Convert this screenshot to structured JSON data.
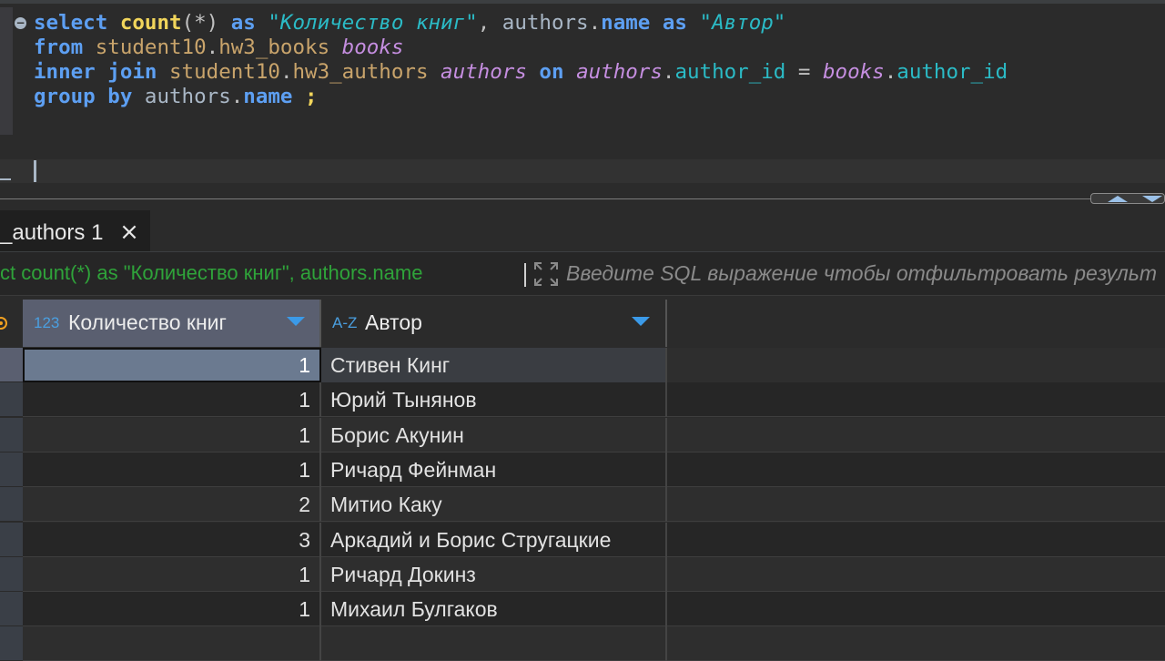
{
  "editor": {
    "lines": [
      [
        {
          "t": "select",
          "c": "kw"
        },
        {
          "t": " ",
          "c": "plain"
        },
        {
          "t": "count",
          "c": "fn"
        },
        {
          "t": "(*)",
          "c": "punct"
        },
        {
          "t": " ",
          "c": "plain"
        },
        {
          "t": "as",
          "c": "kw"
        },
        {
          "t": " ",
          "c": "plain"
        },
        {
          "t": "\"Количество книг\"",
          "c": "str"
        },
        {
          "t": ", ",
          "c": "punct"
        },
        {
          "t": "authors",
          "c": "plain"
        },
        {
          "t": ".",
          "c": "punct"
        },
        {
          "t": "name",
          "c": "kw"
        },
        {
          "t": " ",
          "c": "plain"
        },
        {
          "t": "as",
          "c": "kw"
        },
        {
          "t": " ",
          "c": "plain"
        },
        {
          "t": "\"Автор\"",
          "c": "str"
        }
      ],
      [
        {
          "t": "from",
          "c": "kw"
        },
        {
          "t": " ",
          "c": "plain"
        },
        {
          "t": "student10",
          "c": "schema"
        },
        {
          "t": ".",
          "c": "punct"
        },
        {
          "t": "hw3_books",
          "c": "schema"
        },
        {
          "t": " ",
          "c": "plain"
        },
        {
          "t": "books",
          "c": "alias"
        }
      ],
      [
        {
          "t": "inner",
          "c": "kw"
        },
        {
          "t": " ",
          "c": "plain"
        },
        {
          "t": "join",
          "c": "kw"
        },
        {
          "t": " ",
          "c": "plain"
        },
        {
          "t": "student10",
          "c": "schema"
        },
        {
          "t": ".",
          "c": "punct"
        },
        {
          "t": "hw3_authors",
          "c": "schema"
        },
        {
          "t": " ",
          "c": "plain"
        },
        {
          "t": "authors",
          "c": "alias"
        },
        {
          "t": " ",
          "c": "plain"
        },
        {
          "t": "on",
          "c": "kw"
        },
        {
          "t": " ",
          "c": "plain"
        },
        {
          "t": "authors",
          "c": "alias"
        },
        {
          "t": ".",
          "c": "punct"
        },
        {
          "t": "author_id",
          "c": "col"
        },
        {
          "t": " = ",
          "c": "punct"
        },
        {
          "t": "books",
          "c": "alias"
        },
        {
          "t": ".",
          "c": "punct"
        },
        {
          "t": "author_id",
          "c": "col"
        }
      ],
      [
        {
          "t": "group",
          "c": "kw"
        },
        {
          "t": " ",
          "c": "plain"
        },
        {
          "t": "by",
          "c": "kw"
        },
        {
          "t": " ",
          "c": "plain"
        },
        {
          "t": "authors",
          "c": "plain"
        },
        {
          "t": ".",
          "c": "punct"
        },
        {
          "t": "name",
          "c": "kw"
        },
        {
          "t": " ",
          "c": "plain"
        },
        {
          "t": ";",
          "c": "semi"
        }
      ]
    ],
    "fold_icon": "collapse-icon"
  },
  "tab": {
    "label": "_authors 1",
    "close_glyph": "×"
  },
  "filter": {
    "query_text": "ct count(*) as \"Количество книг\", authors.name",
    "placeholder": "Введите SQL выражение чтобы отфильтровать результ"
  },
  "grid": {
    "columns": [
      {
        "type_badge": "123",
        "label": "Количество книг"
      },
      {
        "type_badge": "A-Z",
        "label": "Автор"
      }
    ],
    "rows": [
      {
        "count": "1",
        "author": "Стивен Кинг"
      },
      {
        "count": "1",
        "author": "Юрий Тынянов"
      },
      {
        "count": "1",
        "author": "Борис Акунин"
      },
      {
        "count": "1",
        "author": "Ричард Фейнман"
      },
      {
        "count": "2",
        "author": "Митио Каку"
      },
      {
        "count": "3",
        "author": "Аркадий и Борис Стругацкие"
      },
      {
        "count": "1",
        "author": "Ричард Докинз"
      },
      {
        "count": "1",
        "author": "Михаил Булгаков"
      }
    ]
  },
  "colors": {
    "keyword": "#5d9ff2",
    "string": "#2bbbc6",
    "function": "#f1d55b",
    "schema": "#c9a46b",
    "alias": "#c58ee0",
    "query_green": "#2fa33a",
    "sort_arrow": "#3b9ae8"
  }
}
